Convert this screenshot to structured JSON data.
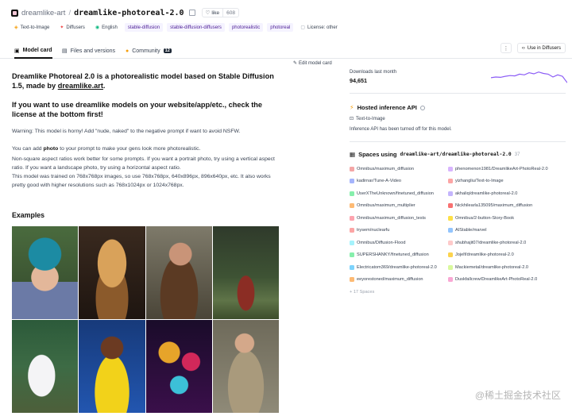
{
  "header": {
    "org": "dreamlike-art",
    "separator": "/",
    "repo": "dreamlike-photoreal-2.0",
    "like_label": "like",
    "like_count": "608"
  },
  "tags": [
    {
      "label": "Text-to-Image",
      "icon": "text-to-image-icon",
      "style": "plain"
    },
    {
      "label": "Diffusers",
      "icon": "diffusers-icon",
      "style": "plain"
    },
    {
      "label": "English",
      "icon": "language-icon",
      "style": "plain"
    },
    {
      "label": "stable-diffusion",
      "style": "purple"
    },
    {
      "label": "stable-diffusion-diffusers",
      "style": "purple"
    },
    {
      "label": "photorealistic",
      "style": "purple"
    },
    {
      "label": "photoreal",
      "style": "purple"
    },
    {
      "label": "License: other",
      "icon": "license-icon",
      "style": "plain"
    }
  ],
  "tabs": {
    "model_card": "Model card",
    "files": "Files and versions",
    "community": "Community",
    "community_count": "12"
  },
  "actions": {
    "more": "⋮",
    "use_in_diffusers": "Use in Diffusers",
    "edit_model_card": "Edit model card"
  },
  "card": {
    "lead_part1": "Dreamlike Photoreal 2.0 is a photorealistic model based on Stable Diffusion 1.5, made by ",
    "lead_link": "dreamlike.art",
    "lead_part2": ".",
    "license_heading": "If you want to use dreamlike models on your website/app/etc., check the license at the bottom first!",
    "warning": "Warning: This model is horny! Add \"nude, naked\" to the negative prompt if want to avoid NSFW.",
    "tip_prefix": "You can add ",
    "tip_bold": "photo",
    "tip_suffix": " to your prompt to make your gens look more photorealistic.",
    "aspect": "Non-square aspect ratios work better for some prompts. If you want a portrait photo, try using a vertical aspect ratio. If you want a landscape photo, try using a horizontal aspect ratio.",
    "trained": "This model was trained on 768x768px images, so use 768x768px, 640x896px, 896x640px, etc. It also works pretty good with higher resolutions such as 768x1024px or 1024x768px.",
    "examples_heading": "Examples"
  },
  "downloads": {
    "label": "Downloads last month",
    "value": "94,651",
    "trend": [
      0.55,
      0.5,
      0.52,
      0.45,
      0.4,
      0.42,
      0.3,
      0.35,
      0.2,
      0.28,
      0.15,
      0.25,
      0.3,
      0.5,
      0.35,
      0.45,
      0.9
    ]
  },
  "inference": {
    "heading": "Hosted inference API",
    "task": "Text-to-Image",
    "status": "Inference API has been turned off for this model."
  },
  "spaces": {
    "heading_prefix": "Spaces using",
    "model": "dreamlike-art/dreamlike-photoreal-2.0",
    "count": "37",
    "more": "+ 17 Spaces",
    "items": [
      {
        "name": "Omnibus/maximum_diffusion",
        "color": "#f4a6a6"
      },
      {
        "name": "phenomenon1981/DreamlikeArt-PhotoReal-2.0",
        "color": "#d8b4fe"
      },
      {
        "name": "kadirnar/Tune-A-Video",
        "color": "#a5b4fc"
      },
      {
        "name": "yizhangliu/Text-to-Image",
        "color": "#fca5a5"
      },
      {
        "name": "UserXTheUnknown/finetuned_diffusion",
        "color": "#86efac"
      },
      {
        "name": "akhaliq/dreamlike-photoreal-2.0",
        "color": "#c4b5fd"
      },
      {
        "name": "Omnibus/maximum_multiplier",
        "color": "#fdba74"
      },
      {
        "name": "Nickhilearla135095/maximum_diffusion",
        "color": "#f87171"
      },
      {
        "name": "Omnibus/maximum_diffusion_tests",
        "color": "#fda4af"
      },
      {
        "name": "Omnibus/2-button-Story-Book",
        "color": "#fde047"
      },
      {
        "name": "trysem/nuclearfu",
        "color": "#fca5a5"
      },
      {
        "name": "AIStable/marvel",
        "color": "#93c5fd"
      },
      {
        "name": "Omnibus/Diffusion-Flood",
        "color": "#a5f3fc"
      },
      {
        "name": "shubhajit07/dreamlike-photoreal-2.0",
        "color": "#fecaca"
      },
      {
        "name": "SUPERSHANKY/finetuned_diffusion",
        "color": "#86efac"
      },
      {
        "name": "Jojelf/dreamlike-photoreal-2.0",
        "color": "#fcd34d"
      },
      {
        "name": "Electricatom369/dreamlike-photoreal-2.0",
        "color": "#7dd3fc"
      },
      {
        "name": "Mackiemetal/dreamlike-photoreal-2.0",
        "color": "#d9f99d"
      },
      {
        "name": "eeyorestoned/maximum_diffusion",
        "color": "#fdba74"
      },
      {
        "name": "Duskfallcrew/DreamlikeArt-PhotoReal-2.0",
        "color": "#f9a8d4"
      }
    ]
  },
  "watermark": "@稀土掘金技术社区"
}
